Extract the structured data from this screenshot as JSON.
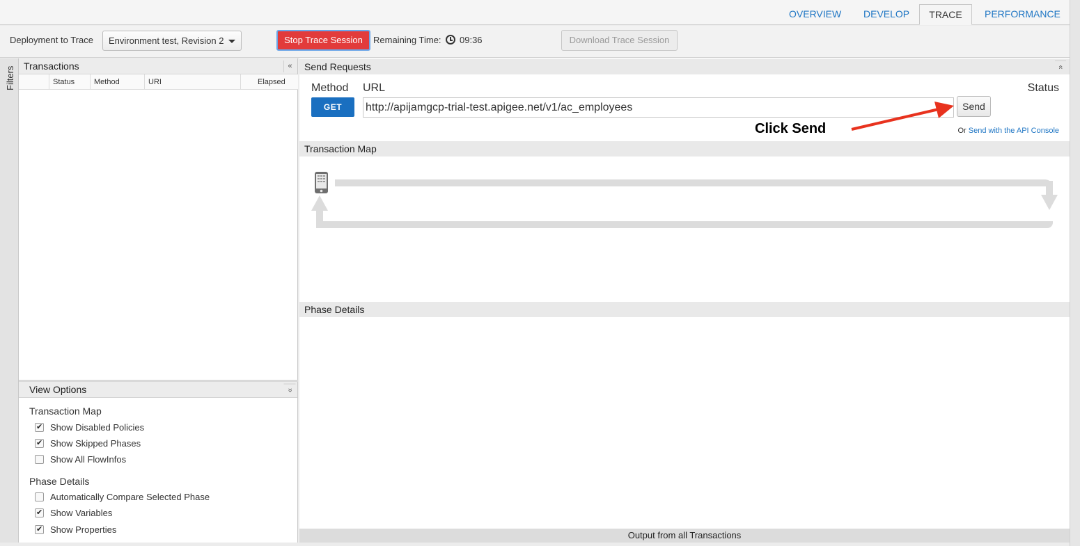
{
  "tabs": [
    {
      "label": "OVERVIEW",
      "active": false
    },
    {
      "label": "DEVELOP",
      "active": false
    },
    {
      "label": "TRACE",
      "active": true
    },
    {
      "label": "PERFORMANCE",
      "active": false
    }
  ],
  "toolbar": {
    "deployment_label": "Deployment to Trace",
    "deployment_value": "Environment test, Revision 2",
    "stop_label": "Stop Trace Session",
    "remaining_label": "Remaining Time:",
    "remaining_value": "09:36",
    "download_label": "Download Trace Session"
  },
  "filters": {
    "label": "Filters"
  },
  "transactions": {
    "title": "Transactions",
    "collapse_glyph": "«",
    "columns": [
      "",
      "Status",
      "Method",
      "URI",
      "Elapsed"
    ]
  },
  "view_options": {
    "title": "View Options",
    "collapse_glyph": "»",
    "sections": [
      {
        "title": "Transaction Map",
        "items": [
          {
            "label": "Show Disabled Policies",
            "checked": true
          },
          {
            "label": "Show Skipped Phases",
            "checked": true
          },
          {
            "label": "Show All FlowInfos",
            "checked": false
          }
        ]
      },
      {
        "title": "Phase Details",
        "items": [
          {
            "label": "Automatically Compare Selected Phase",
            "checked": false
          },
          {
            "label": "Show Variables",
            "checked": true
          },
          {
            "label": "Show Properties",
            "checked": true
          }
        ]
      }
    ]
  },
  "send_requests": {
    "title": "Send Requests",
    "collapse_glyph": "«",
    "method_label": "Method",
    "url_label": "URL",
    "status_label": "Status",
    "method_value": "GET",
    "url_value": "http://apijamgcp-trial-test.apigee.net/v1/ac_employees",
    "send_label": "Send",
    "annotation": "Click Send",
    "or_text": "Or",
    "console_link": "Send with the API Console"
  },
  "transaction_map": {
    "title": "Transaction Map"
  },
  "phase_details": {
    "title": "Phase Details"
  },
  "output_bar": {
    "label": "Output from all Transactions"
  },
  "colors": {
    "accent_blue": "#1f76c4",
    "get_button": "#1a6fc0",
    "stop_button": "#e23b3b",
    "annotation_arrow": "#e8321e"
  }
}
